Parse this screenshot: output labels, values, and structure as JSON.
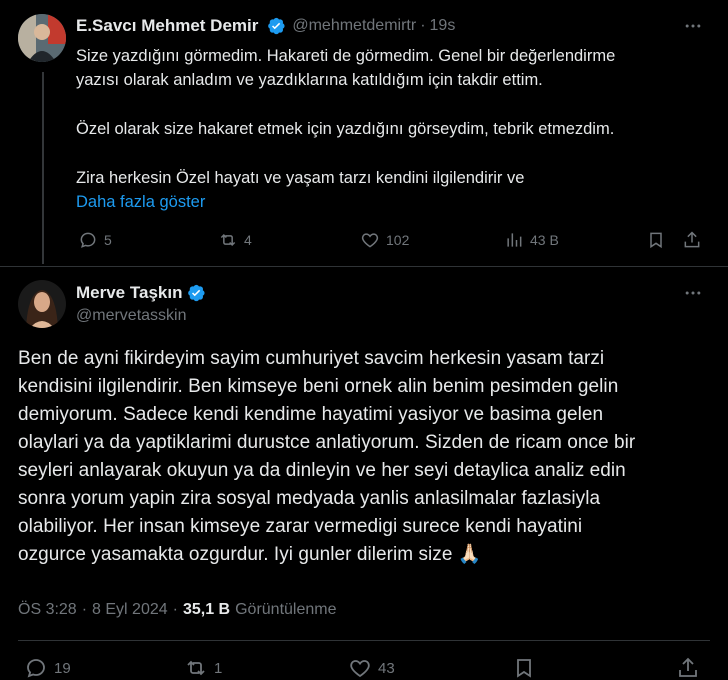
{
  "reply": {
    "author_name": "E.Savcı Mehmet Demir",
    "handle": "@mehmetdemirtr",
    "separator": "·",
    "time": "19s",
    "paragraphs": [
      "Size yazdığını görmedim. Hakareti de görmedim. Genel bir değerlendirme",
      "yazısı olarak anladım ve yazdıklarına katıldığım için takdir ettim.",
      "Özel olarak size hakaret etmek için yazdığını görseydim, tebrik etmezdim.",
      "Zira herkesin Özel hayatı ve yaşam tarzı kendini ilgilendirir ve"
    ],
    "show_more": "Daha fazla göster",
    "actions": {
      "replies": "5",
      "reposts": "4",
      "likes": "102",
      "views": "43 B"
    }
  },
  "main_tweet": {
    "author_name": "Merve Taşkın",
    "handle": "@mervetasskin",
    "lines": [
      "Ben de ayni fikirdeyim sayim cumhuriyet savcim herkesin yasam tarzi",
      "kendisini ilgilendirir. Ben kimseye beni ornek alin benim pesimden gelin",
      "demiyorum. Sadece kendi kendime hayatimi yasiyor ve basima gelen",
      "olaylari ya da yaptiklarimi durustce anlatiyorum. Sizden de ricam once bir",
      "seyleri anlayarak okuyun ya da dinleyin ve her seyi detaylica analiz edin",
      "sonra yorum yapin zira sosyal medyada yanlis anlasilmalar fazlasiyla",
      "olabiliyor. Her insan kimseye zarar vermedigi surece kendi hayatini",
      "ozgurce yasamakta ozgurdur. Iyi gunler dilerim size 🙏🏻"
    ],
    "time": "ÖS 3:28",
    "dot": "·",
    "date": "8 Eyl 2024",
    "views_count": "35,1 B",
    "views_label": "Görüntülenme",
    "actions": {
      "replies": "19",
      "reposts": "1",
      "likes": "43"
    }
  },
  "colors": {
    "background": "#000000",
    "text": "#e7e9ea",
    "muted": "#71767b",
    "accent": "#1d9bf0",
    "separator": "#2f3336"
  }
}
